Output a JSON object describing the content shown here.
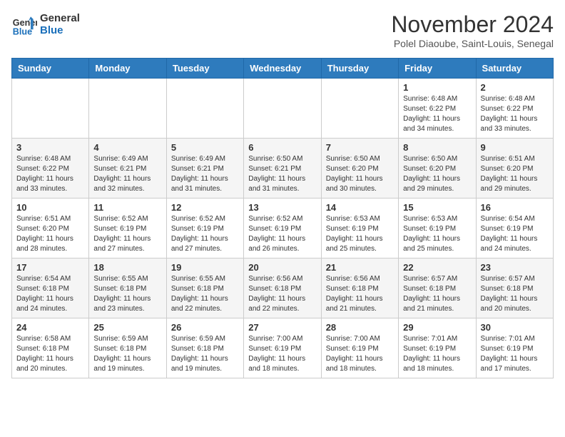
{
  "header": {
    "logo_line1": "General",
    "logo_line2": "Blue",
    "month": "November 2024",
    "location": "Polel Diaoube, Saint-Louis, Senegal"
  },
  "weekdays": [
    "Sunday",
    "Monday",
    "Tuesday",
    "Wednesday",
    "Thursday",
    "Friday",
    "Saturday"
  ],
  "weeks": [
    [
      {
        "day": "",
        "info": ""
      },
      {
        "day": "",
        "info": ""
      },
      {
        "day": "",
        "info": ""
      },
      {
        "day": "",
        "info": ""
      },
      {
        "day": "",
        "info": ""
      },
      {
        "day": "1",
        "info": "Sunrise: 6:48 AM\nSunset: 6:22 PM\nDaylight: 11 hours\nand 34 minutes."
      },
      {
        "day": "2",
        "info": "Sunrise: 6:48 AM\nSunset: 6:22 PM\nDaylight: 11 hours\nand 33 minutes."
      }
    ],
    [
      {
        "day": "3",
        "info": "Sunrise: 6:48 AM\nSunset: 6:22 PM\nDaylight: 11 hours\nand 33 minutes."
      },
      {
        "day": "4",
        "info": "Sunrise: 6:49 AM\nSunset: 6:21 PM\nDaylight: 11 hours\nand 32 minutes."
      },
      {
        "day": "5",
        "info": "Sunrise: 6:49 AM\nSunset: 6:21 PM\nDaylight: 11 hours\nand 31 minutes."
      },
      {
        "day": "6",
        "info": "Sunrise: 6:50 AM\nSunset: 6:21 PM\nDaylight: 11 hours\nand 31 minutes."
      },
      {
        "day": "7",
        "info": "Sunrise: 6:50 AM\nSunset: 6:20 PM\nDaylight: 11 hours\nand 30 minutes."
      },
      {
        "day": "8",
        "info": "Sunrise: 6:50 AM\nSunset: 6:20 PM\nDaylight: 11 hours\nand 29 minutes."
      },
      {
        "day": "9",
        "info": "Sunrise: 6:51 AM\nSunset: 6:20 PM\nDaylight: 11 hours\nand 29 minutes."
      }
    ],
    [
      {
        "day": "10",
        "info": "Sunrise: 6:51 AM\nSunset: 6:20 PM\nDaylight: 11 hours\nand 28 minutes."
      },
      {
        "day": "11",
        "info": "Sunrise: 6:52 AM\nSunset: 6:19 PM\nDaylight: 11 hours\nand 27 minutes."
      },
      {
        "day": "12",
        "info": "Sunrise: 6:52 AM\nSunset: 6:19 PM\nDaylight: 11 hours\nand 27 minutes."
      },
      {
        "day": "13",
        "info": "Sunrise: 6:52 AM\nSunset: 6:19 PM\nDaylight: 11 hours\nand 26 minutes."
      },
      {
        "day": "14",
        "info": "Sunrise: 6:53 AM\nSunset: 6:19 PM\nDaylight: 11 hours\nand 25 minutes."
      },
      {
        "day": "15",
        "info": "Sunrise: 6:53 AM\nSunset: 6:19 PM\nDaylight: 11 hours\nand 25 minutes."
      },
      {
        "day": "16",
        "info": "Sunrise: 6:54 AM\nSunset: 6:19 PM\nDaylight: 11 hours\nand 24 minutes."
      }
    ],
    [
      {
        "day": "17",
        "info": "Sunrise: 6:54 AM\nSunset: 6:18 PM\nDaylight: 11 hours\nand 24 minutes."
      },
      {
        "day": "18",
        "info": "Sunrise: 6:55 AM\nSunset: 6:18 PM\nDaylight: 11 hours\nand 23 minutes."
      },
      {
        "day": "19",
        "info": "Sunrise: 6:55 AM\nSunset: 6:18 PM\nDaylight: 11 hours\nand 22 minutes."
      },
      {
        "day": "20",
        "info": "Sunrise: 6:56 AM\nSunset: 6:18 PM\nDaylight: 11 hours\nand 22 minutes."
      },
      {
        "day": "21",
        "info": "Sunrise: 6:56 AM\nSunset: 6:18 PM\nDaylight: 11 hours\nand 21 minutes."
      },
      {
        "day": "22",
        "info": "Sunrise: 6:57 AM\nSunset: 6:18 PM\nDaylight: 11 hours\nand 21 minutes."
      },
      {
        "day": "23",
        "info": "Sunrise: 6:57 AM\nSunset: 6:18 PM\nDaylight: 11 hours\nand 20 minutes."
      }
    ],
    [
      {
        "day": "24",
        "info": "Sunrise: 6:58 AM\nSunset: 6:18 PM\nDaylight: 11 hours\nand 20 minutes."
      },
      {
        "day": "25",
        "info": "Sunrise: 6:59 AM\nSunset: 6:18 PM\nDaylight: 11 hours\nand 19 minutes."
      },
      {
        "day": "26",
        "info": "Sunrise: 6:59 AM\nSunset: 6:18 PM\nDaylight: 11 hours\nand 19 minutes."
      },
      {
        "day": "27",
        "info": "Sunrise: 7:00 AM\nSunset: 6:19 PM\nDaylight: 11 hours\nand 18 minutes."
      },
      {
        "day": "28",
        "info": "Sunrise: 7:00 AM\nSunset: 6:19 PM\nDaylight: 11 hours\nand 18 minutes."
      },
      {
        "day": "29",
        "info": "Sunrise: 7:01 AM\nSunset: 6:19 PM\nDaylight: 11 hours\nand 18 minutes."
      },
      {
        "day": "30",
        "info": "Sunrise: 7:01 AM\nSunset: 6:19 PM\nDaylight: 11 hours\nand 17 minutes."
      }
    ]
  ]
}
